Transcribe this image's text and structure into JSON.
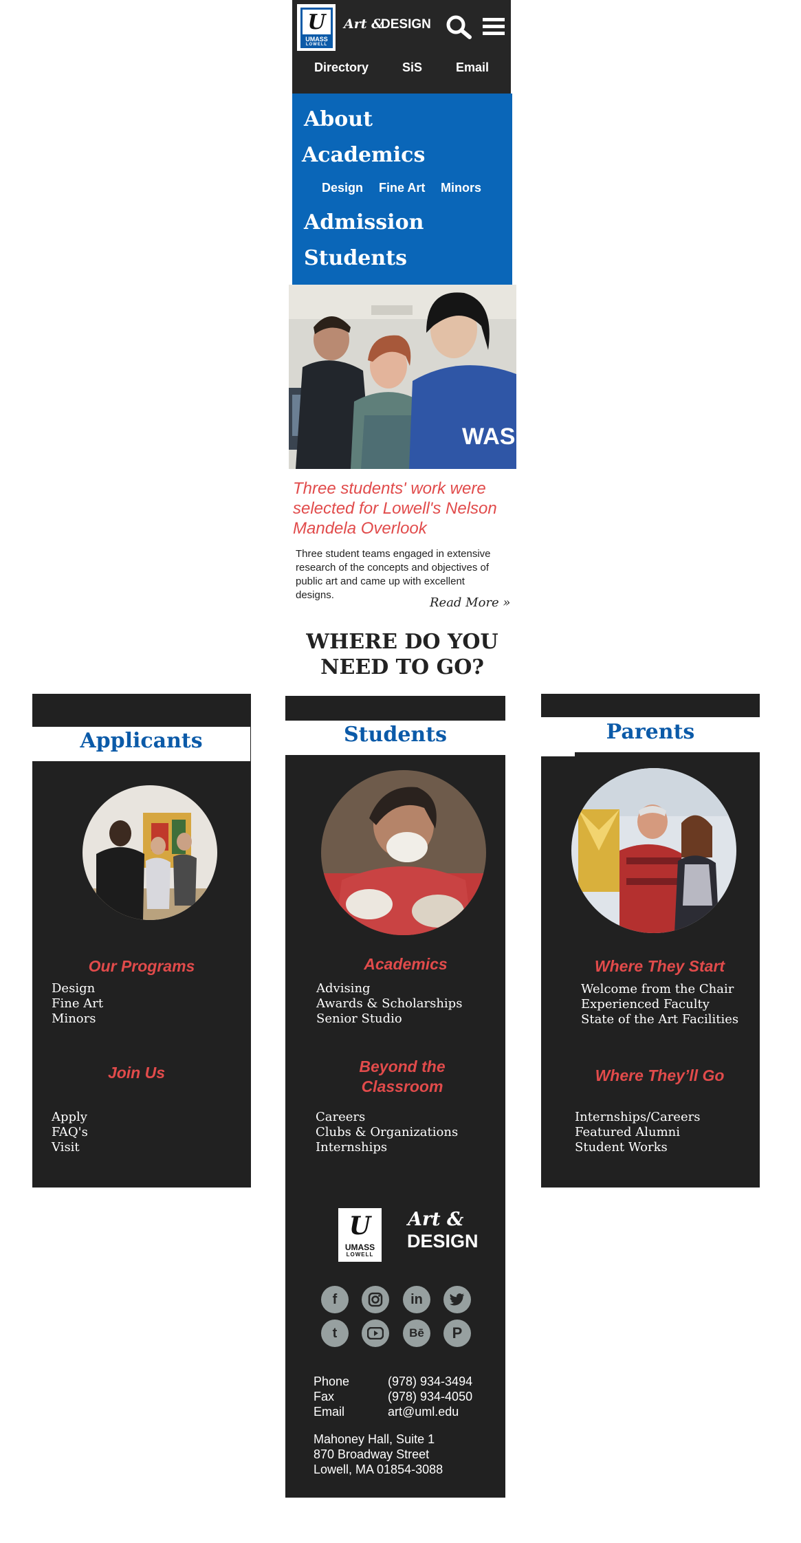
{
  "header": {
    "logo_text": "UMASS",
    "logo_sub": "LOWELL",
    "brand_art": "Art &",
    "brand_design": "DESIGN",
    "links": [
      "Directory",
      "SiS",
      "Email"
    ]
  },
  "menu": {
    "main": [
      "About",
      "Academics",
      "Admission",
      "Students"
    ],
    "sub": [
      "Design",
      "Fine Art",
      "Minors"
    ]
  },
  "news": {
    "title": "Three students' work were selected for Lowell's Nelson Mandela Overlook",
    "body": "Three student teams engaged in extensive research of the concepts and objectives of public art and came up with excellent designs.",
    "read_more": "Read More »"
  },
  "where": "WHERE DO YOU NEED TO GO?",
  "columns": {
    "applicants": {
      "title": "Applicants",
      "section1": "Our Programs",
      "items1": [
        "Design",
        "Fine Art",
        "Minors"
      ],
      "section2": "Join Us",
      "items2": [
        "Apply",
        "FAQ's",
        "Visit"
      ]
    },
    "students": {
      "title": "Students",
      "section1": "Academics",
      "items1": [
        "Advising",
        "Awards & Scholarships",
        "Senior Studio"
      ],
      "section2": "Beyond the Classroom",
      "items2": [
        "Careers",
        "Clubs & Organizations",
        "Internships"
      ]
    },
    "parents": {
      "title": "Parents",
      "section1": "Where They Start",
      "items1": [
        "Welcome from the Chair",
        "Experienced Faculty",
        "State of the Art Facilities"
      ],
      "section2": "Where They’ll  Go",
      "items2": [
        "Internships/Careers",
        "Featured Alumni",
        "Student Works"
      ]
    }
  },
  "footer": {
    "brand_art": "Art  &",
    "brand_design": "DESIGN",
    "social": [
      "facebook-icon",
      "instagram-icon",
      "linkedin-icon",
      "twitter-icon",
      "tumblr-icon",
      "youtube-icon",
      "behance-icon",
      "pinterest-icon"
    ],
    "contact": {
      "phone_label": "Phone",
      "phone": "(978) 934-3494",
      "fax_label": "Fax",
      "fax": "(978) 934-4050",
      "email_label": "Email",
      "email": "art@uml.edu"
    },
    "address": [
      "Mahoney Hall, Suite 1",
      "870 Broadway Street",
      "Lowell, MA 01854-3088"
    ]
  },
  "colors": {
    "dark": "#212121",
    "blue": "#0a66b8",
    "red": "#e14b4b"
  }
}
